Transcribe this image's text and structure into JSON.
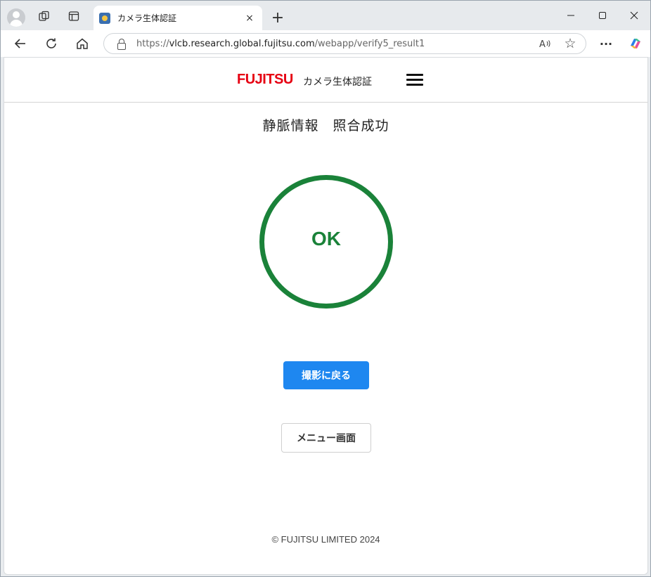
{
  "browser": {
    "tab_title": "カメラ生体認証",
    "url_prefix": "https://",
    "url_host": "vlcb.research.global.fujitsu.com",
    "url_path": "/webapp/verify5_result1",
    "close_tab_glyph": "×",
    "new_tab_glyph": "+",
    "minimize_glyph": "—",
    "maximize_glyph": "☐",
    "close_window_glyph": "✕",
    "back_glyph": "←",
    "refresh_glyph": "↻",
    "home_glyph": "⌂",
    "read_aloud_glyph": "A",
    "favorite_glyph": "☆",
    "more_glyph": "···"
  },
  "header": {
    "logo_text": "FUJITSU",
    "title": "カメラ生体認証"
  },
  "main": {
    "result_title": "静脈情報　照合成功",
    "status_text": "OK",
    "retake_button": "撮影に戻る",
    "menu_button": "メニュー画面"
  },
  "footer": {
    "copyright": "© FUJITSU LIMITED 2024"
  },
  "colors": {
    "success": "#1a8239",
    "primary_button": "#1e87f0",
    "logo_red": "#e60012"
  }
}
